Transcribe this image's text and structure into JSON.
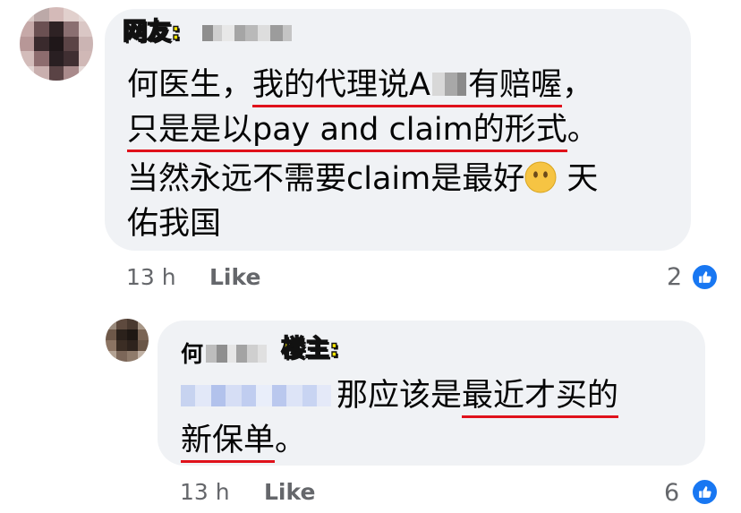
{
  "comment1": {
    "tag": "网友:",
    "line1_pre": "何医生，",
    "line1_underlined_a": "我的代理说A",
    "line1_underlined_b": "有赔喔",
    "line1_post": "，",
    "line2_underlined": "只是是以pay and claim的形式",
    "line2_post": "。",
    "line3": "当然永远不需要claim是最好",
    "line3_tail": " 天",
    "line4": "佑我国",
    "time": "13 h",
    "like_label": "Like",
    "reaction_count": "2"
  },
  "comment2": {
    "name_visible": "何",
    "tag": "楼主:",
    "text_pre": "那应该是",
    "text_underlined": "最近才买的",
    "line2_underlined": "新保单",
    "line2_post": "。",
    "time": "13 h",
    "like_label": "Like",
    "reaction_count": "6"
  },
  "colors": {
    "bubble": "#f0f2f5",
    "underline": "#e0121b",
    "tag_fill": "#f5e400",
    "meta": "#65676b",
    "like_blue": "#1877f2"
  },
  "icons": [
    "blurred-avatar",
    "thumbs-up-icon",
    "neutral-face-emoji"
  ]
}
